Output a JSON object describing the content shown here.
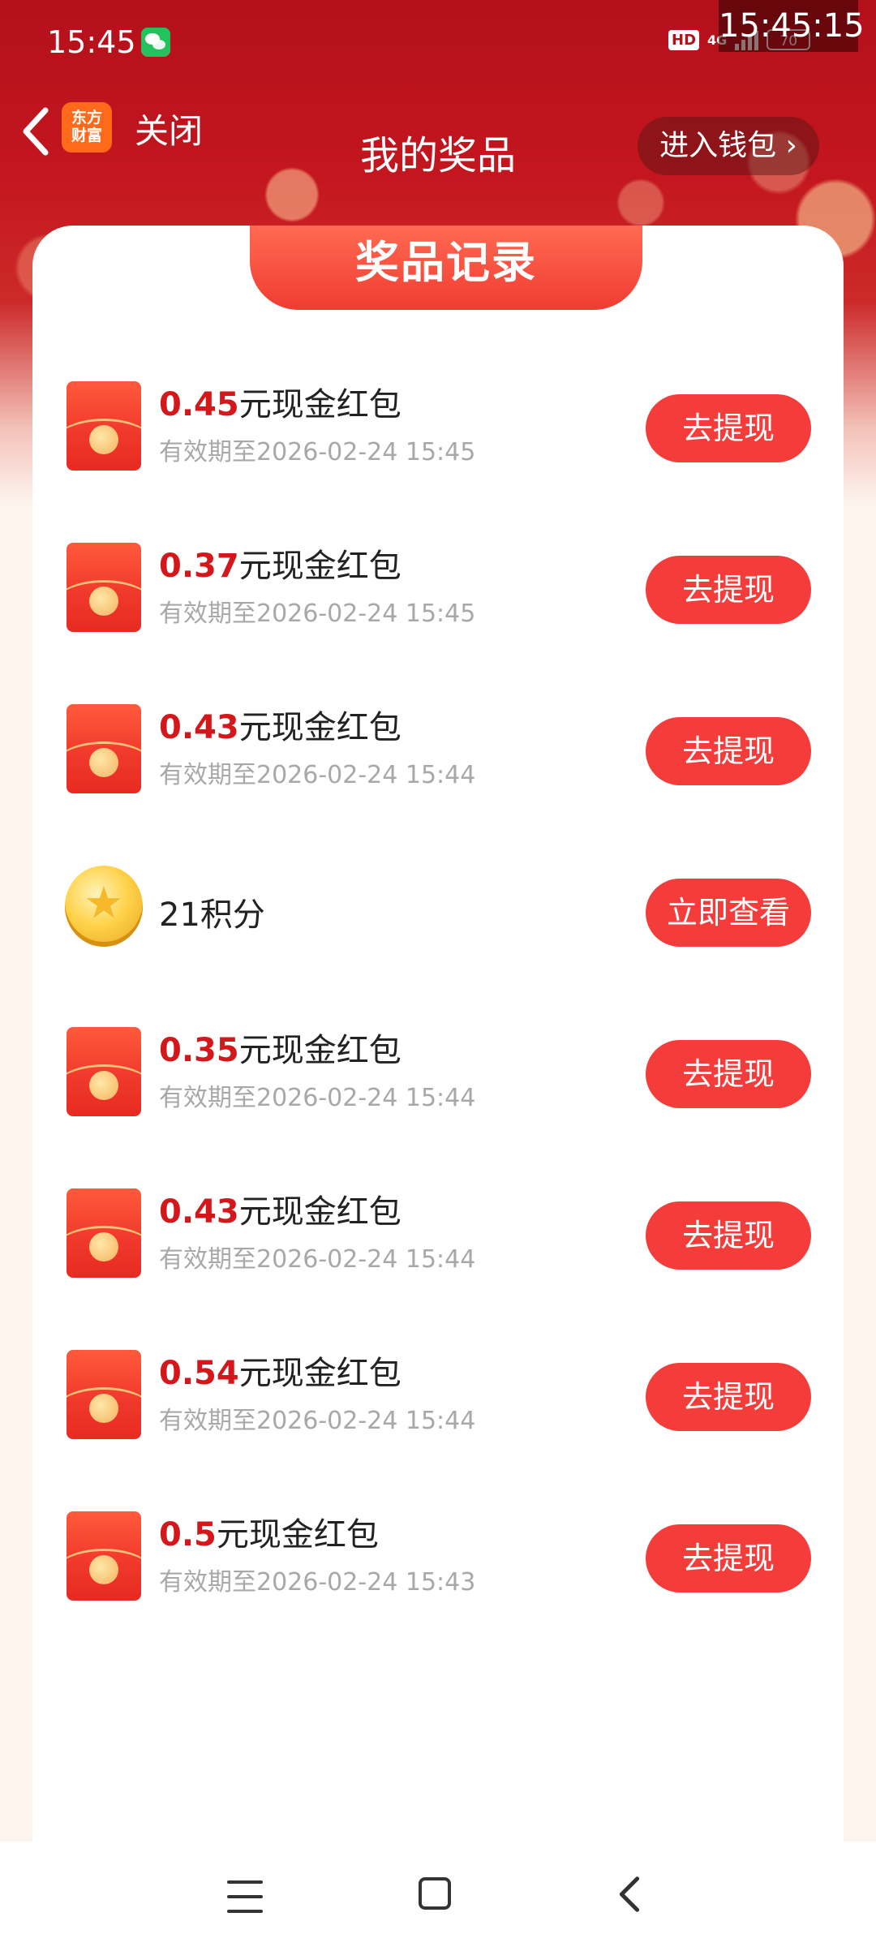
{
  "status_bar": {
    "time": "15:45",
    "hd": "HD",
    "network": "4G",
    "battery": "70",
    "overlay_clock": "15:45:15"
  },
  "header": {
    "app_logo_line1": "东方",
    "app_logo_line2": "财富",
    "close_label": "关闭",
    "title": "我的奖品",
    "wallet_button": "进入钱包"
  },
  "card": {
    "tab_title": "奖品记录"
  },
  "prizes": [
    {
      "type": "red-envelope",
      "amount": "0.45",
      "label": "元现金红包",
      "expiry": "有效期至2026-02-24 15:45",
      "action": "去提现"
    },
    {
      "type": "red-envelope",
      "amount": "0.37",
      "label": "元现金红包",
      "expiry": "有效期至2026-02-24 15:45",
      "action": "去提现"
    },
    {
      "type": "red-envelope",
      "amount": "0.43",
      "label": "元现金红包",
      "expiry": "有效期至2026-02-24 15:44",
      "action": "去提现"
    },
    {
      "type": "points-coin",
      "amount": "",
      "label": "21积分",
      "expiry": "",
      "action": "立即查看"
    },
    {
      "type": "red-envelope",
      "amount": "0.35",
      "label": "元现金红包",
      "expiry": "有效期至2026-02-24 15:44",
      "action": "去提现"
    },
    {
      "type": "red-envelope",
      "amount": "0.43",
      "label": "元现金红包",
      "expiry": "有效期至2026-02-24 15:44",
      "action": "去提现"
    },
    {
      "type": "red-envelope",
      "amount": "0.54",
      "label": "元现金红包",
      "expiry": "有效期至2026-02-24 15:44",
      "action": "去提现"
    },
    {
      "type": "red-envelope",
      "amount": "0.5",
      "label": "元现金红包",
      "expiry": "有效期至2026-02-24 15:43",
      "action": "去提现"
    }
  ],
  "colors": {
    "header_red": "#b3101b",
    "amount_red": "#d3171b",
    "button_red": "#f43c3a",
    "expiry_gray": "#a8a8a8"
  }
}
